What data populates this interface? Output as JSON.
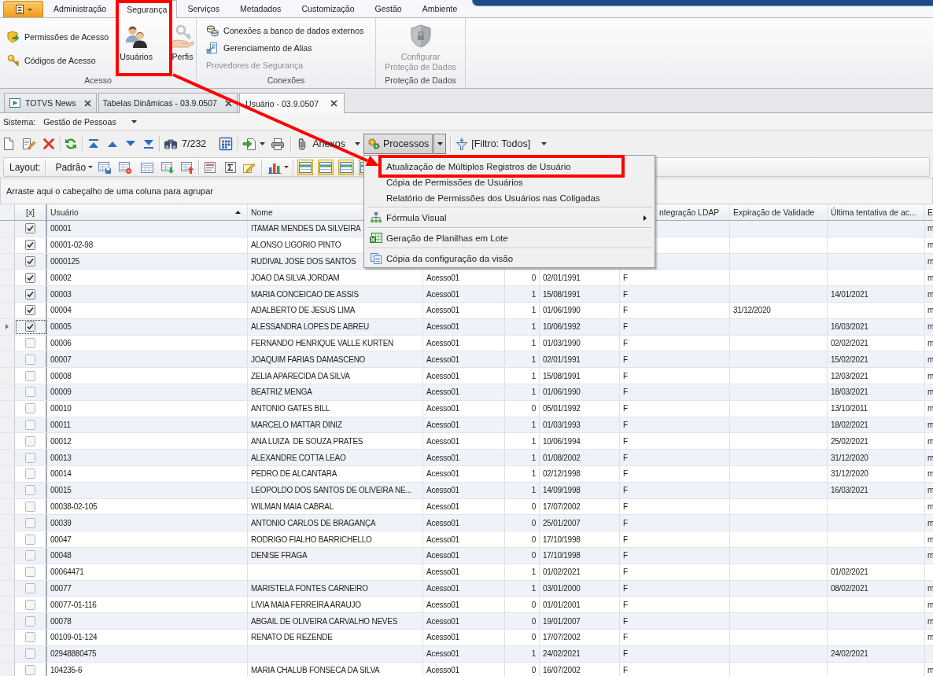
{
  "ribbon": {
    "tabs": [
      {
        "label": "Administração",
        "selected": false
      },
      {
        "label": "Segurança",
        "selected": true
      },
      {
        "label": "Serviços",
        "selected": false
      },
      {
        "label": "Metadados",
        "selected": false
      },
      {
        "label": "Customização",
        "selected": false
      },
      {
        "label": "Gestão",
        "selected": false
      },
      {
        "label": "Ambiente",
        "selected": false
      }
    ],
    "groups": [
      {
        "title": "Acesso",
        "items": [
          {
            "kind": "small",
            "label": "Permissões de Acesso",
            "disabled": false
          },
          {
            "kind": "small",
            "label": "Códigos de Acesso",
            "disabled": false
          },
          {
            "kind": "large",
            "label": "Usuários",
            "disabled": false
          },
          {
            "kind": "large",
            "label": "Perfis",
            "disabled": false
          }
        ]
      },
      {
        "title": "Conexões",
        "items": [
          {
            "kind": "small",
            "label": "Conexões a banco de dados externos",
            "disabled": false
          },
          {
            "kind": "small",
            "label": "Gerenciamento de Alias",
            "disabled": false
          },
          {
            "kind": "small",
            "label": "Provedores de Segurança",
            "disabled": true
          }
        ]
      },
      {
        "title": "Proteção de Dados",
        "items": [
          {
            "kind": "large",
            "label": "Configurar Proteção de Dados",
            "disabled": true
          }
        ]
      }
    ]
  },
  "doc_tabs": [
    {
      "label": "TOTVS News",
      "selected": false
    },
    {
      "label": "Tabelas Dinâmicas - 03.9.0507",
      "selected": false
    },
    {
      "label": "Usuário - 03.9.0507",
      "selected": true
    }
  ],
  "system": {
    "label": "Sistema:",
    "value": "Gestão de Pessoas"
  },
  "toolbar": {
    "record_counter": "7/232",
    "attachments": {
      "label": "Anexos"
    },
    "processes": {
      "label": "Processos",
      "pressed": true
    },
    "filter": {
      "label": "[Filtro: Todos]"
    }
  },
  "layout_bar": {
    "label": "Layout:",
    "value": "Padrão",
    "view_toggles": [
      {
        "on": true
      },
      {
        "on": true
      },
      {
        "on": true
      },
      {
        "on": true
      }
    ]
  },
  "group_panel": {
    "hint": "Arraste aqui o cabeçalho de uma coluna para agrupar"
  },
  "table": {
    "header": {
      "check": {
        "label": "[x]"
      },
      "usuario": {
        "label": "Usuário",
        "sort_ascending": true
      },
      "nome": {
        "label": "Nome"
      },
      "column_7": {
        "label": "ntegração LDAP"
      },
      "expiracao_validade": {
        "label": "Expiração de Validade"
      },
      "ultima_tentativa": {
        "label": "Última tentativa de ac..."
      },
      "column_10": {
        "label": "E"
      }
    },
    "rows": [
      {
        "checked": true,
        "current": false,
        "usuario": "00001",
        "nome": "ITAMAR MENDES DA SILVEIRA",
        "column_10": "m"
      },
      {
        "checked": true,
        "current": false,
        "usuario": "00001-02-98",
        "nome": "ALONSO LIGORIO PINTO",
        "column_10": "m"
      },
      {
        "checked": true,
        "current": false,
        "usuario": "0000125",
        "nome": "RUDIVAL JOSE DOS SANTOS",
        "column_10": "m"
      },
      {
        "checked": true,
        "current": false,
        "usuario": "00002",
        "nome": "JOAO DA SILVA JORDAM",
        "column_4": "Acesso01",
        "column_5": "0",
        "column_6": "02/01/1991",
        "column_7": "F",
        "column_10": "m"
      },
      {
        "checked": true,
        "current": false,
        "usuario": "00003",
        "nome": "MARIA CONCEICAO DE ASSIS",
        "column_4": "Acesso01",
        "column_5": "1",
        "column_6": "15/08/1991",
        "column_7": "F",
        "ultima_tentativa": "14/01/2021",
        "column_10": "m"
      },
      {
        "checked": true,
        "current": false,
        "usuario": "00004",
        "nome": "ADALBERTO DE JESUS LIMA",
        "column_4": "Acesso01",
        "column_5": "1",
        "column_6": "01/06/1990",
        "column_7": "F",
        "expiracao_validade": "31/12/2020",
        "column_10": "m"
      },
      {
        "checked": true,
        "current": true,
        "usuario": "00005",
        "nome": "ALESSANDRA LOPES DE ABREU",
        "column_4": "Acesso01",
        "column_5": "1",
        "column_6": "10/06/1992",
        "column_7": "F",
        "ultima_tentativa": "16/03/2021",
        "column_10": "m"
      },
      {
        "checked": false,
        "current": false,
        "usuario": "00006",
        "nome": "FERNANDO HENRIQUE VALLE KURTEN",
        "column_4": "Acesso01",
        "column_5": "1",
        "column_6": "01/03/1990",
        "column_7": "F",
        "ultima_tentativa": "02/02/2021",
        "column_10": "m"
      },
      {
        "checked": false,
        "current": false,
        "usuario": "00007",
        "nome": "JOAQUIM FARIAS DAMASCENO",
        "column_4": "Acesso01",
        "column_5": "1",
        "column_6": "02/01/1991",
        "column_7": "F",
        "ultima_tentativa": "15/02/2021",
        "column_10": "m"
      },
      {
        "checked": false,
        "current": false,
        "usuario": "00008",
        "nome": "ZELIA APARECIDA DA SILVA",
        "column_4": "Acesso01",
        "column_5": "1",
        "column_6": "15/08/1991",
        "column_7": "F",
        "ultima_tentativa": "12/03/2021",
        "column_10": "m"
      },
      {
        "checked": false,
        "current": false,
        "usuario": "00009",
        "nome": "BEATRIZ MENGA",
        "column_4": "Acesso01",
        "column_5": "1",
        "column_6": "01/06/1990",
        "column_7": "F",
        "ultima_tentativa": "18/03/2021",
        "column_10": "m"
      },
      {
        "checked": false,
        "current": false,
        "usuario": "00010",
        "nome": "ANTONIO GATES BILL",
        "column_4": "Acesso01",
        "column_5": "0",
        "column_6": "05/01/1992",
        "column_7": "F",
        "ultima_tentativa": "13/10/2011",
        "column_10": "m"
      },
      {
        "checked": false,
        "current": false,
        "usuario": "00011",
        "nome": "MARCELO MATTAR DINIZ",
        "column_4": "Acesso01",
        "column_5": "1",
        "column_6": "01/03/1993",
        "column_7": "F",
        "ultima_tentativa": "18/02/2021",
        "column_10": "m"
      },
      {
        "checked": false,
        "current": false,
        "usuario": "00012",
        "nome": "ANA LUIZA  DE SOUZA PRATES",
        "column_4": "Acesso01",
        "column_5": "1",
        "column_6": "10/06/1994",
        "column_7": "F",
        "ultima_tentativa": "25/02/2021",
        "column_10": "m"
      },
      {
        "checked": false,
        "current": false,
        "usuario": "00013",
        "nome": "ALEXANDRE COTTA LEAO",
        "column_4": "Acesso01",
        "column_5": "1",
        "column_6": "01/08/2002",
        "column_7": "F",
        "ultima_tentativa": "31/12/2020",
        "column_10": "m"
      },
      {
        "checked": false,
        "current": false,
        "usuario": "00014",
        "nome": "PEDRO DE ALCANTARA",
        "column_4": "Acesso01",
        "column_5": "1",
        "column_6": "02/12/1998",
        "column_7": "F",
        "ultima_tentativa": "31/12/2020",
        "column_10": "m"
      },
      {
        "checked": false,
        "current": false,
        "usuario": "00015",
        "nome": "LEOPOLDO DOS SANTOS DE OLIVEIRA NE...",
        "column_4": "Acesso01",
        "column_5": "1",
        "column_6": "14/09/1998",
        "column_7": "F",
        "ultima_tentativa": "16/03/2021",
        "column_10": "m"
      },
      {
        "checked": false,
        "current": false,
        "usuario": "00038-02-105",
        "nome": "WILMAN MAIA CABRAL",
        "column_4": "Acesso01",
        "column_5": "0",
        "column_6": "17/07/2002",
        "column_7": "F",
        "column_10": "m"
      },
      {
        "checked": false,
        "current": false,
        "usuario": "00039",
        "nome": "ANTONIO CARLOS DE BRAGANÇA",
        "column_4": "Acesso01",
        "column_5": "0",
        "column_6": "25/01/2007",
        "column_7": "F",
        "column_10": "m"
      },
      {
        "checked": false,
        "current": false,
        "usuario": "00047",
        "nome": "RODRIGO FIALHO BARRICHELLO",
        "column_4": "Acesso01",
        "column_5": "0",
        "column_6": "17/10/1998",
        "column_7": "F",
        "column_10": "m"
      },
      {
        "checked": false,
        "current": false,
        "usuario": "00048",
        "nome": "DENISE FRAGA",
        "column_4": "Acesso01",
        "column_5": "0",
        "column_6": "17/10/1998",
        "column_7": "F",
        "column_10": "m"
      },
      {
        "checked": false,
        "current": false,
        "usuario": "00064471",
        "column_4": "Acesso01",
        "column_5": "1",
        "column_6": "01/02/2021",
        "column_7": "F",
        "ultima_tentativa": "01/02/2021"
      },
      {
        "checked": false,
        "current": false,
        "usuario": "00077",
        "nome": "MARISTELA FONTES CARNEIRO",
        "column_4": "Acesso01",
        "column_5": "1",
        "column_6": "03/01/2000",
        "column_7": "F",
        "ultima_tentativa": "08/02/2021",
        "column_10": "m"
      },
      {
        "checked": false,
        "current": false,
        "usuario": "00077-01-116",
        "nome": "LIVIA MAIA FERREIRA ARAUJO",
        "column_4": "Acesso01",
        "column_5": "0",
        "column_6": "01/01/2001",
        "column_7": "F",
        "column_10": "m"
      },
      {
        "checked": false,
        "current": false,
        "usuario": "00078",
        "nome": "ABGAIL DE OLIVEIRA CARVALHO NEVES",
        "column_4": "Acesso01",
        "column_5": "0",
        "column_6": "19/01/2007",
        "column_7": "F",
        "column_10": "m"
      },
      {
        "checked": false,
        "current": false,
        "usuario": "00109-01-124",
        "nome": "RENATO DE REZENDE",
        "column_4": "Acesso01",
        "column_5": "0",
        "column_6": "17/07/2002",
        "column_7": "F",
        "column_10": "m"
      },
      {
        "checked": false,
        "current": false,
        "usuario": "02948880475",
        "column_4": "Acesso01",
        "column_5": "1",
        "column_6": "24/02/2021",
        "column_7": "F",
        "ultima_tentativa": "24/02/2021"
      },
      {
        "checked": false,
        "current": false,
        "usuario": "104235-6",
        "nome": "MARIA CHALUB FONSECA DA SILVA",
        "column_4": "Acesso01",
        "column_5": "0",
        "column_6": "16/07/2002",
        "column_7": "F",
        "column_10": "m"
      }
    ]
  },
  "menu": {
    "sections": [
      {
        "items": [
          {
            "label": "Atualização de Múltiplos Registros de Usuário",
            "submenu": false
          },
          {
            "label": "Cópia de Permissões de Usuários",
            "submenu": false
          },
          {
            "label": "Relatório de Permissões dos Usuários nas Coligadas",
            "submenu": false
          }
        ]
      },
      {
        "items": [
          {
            "label": "Fórmula Visual",
            "submenu": true
          }
        ]
      },
      {
        "items": [
          {
            "label": "Geração de Planilhas em Lote",
            "submenu": false
          }
        ]
      },
      {
        "items": [
          {
            "label": "Cópia da configuração da visão",
            "submenu": false
          }
        ]
      }
    ]
  }
}
